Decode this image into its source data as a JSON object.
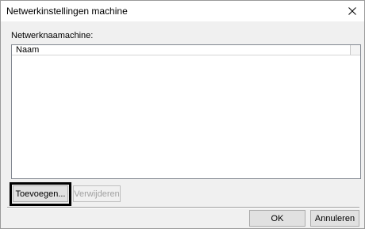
{
  "window": {
    "title": "Netwerkinstellingen machine"
  },
  "main": {
    "field_label": "Netwerknaamachine:",
    "list": {
      "columns": [
        "Naam"
      ],
      "rows": []
    }
  },
  "buttons": {
    "add_label": "Toevoegen...",
    "remove_label": "Verwijderen",
    "ok_label": "OK",
    "cancel_label": "Annuleren"
  },
  "icons": {
    "close": "close-icon"
  },
  "colors": {
    "highlight_border": "#000000",
    "dialog_background": "#f0f0f0"
  }
}
